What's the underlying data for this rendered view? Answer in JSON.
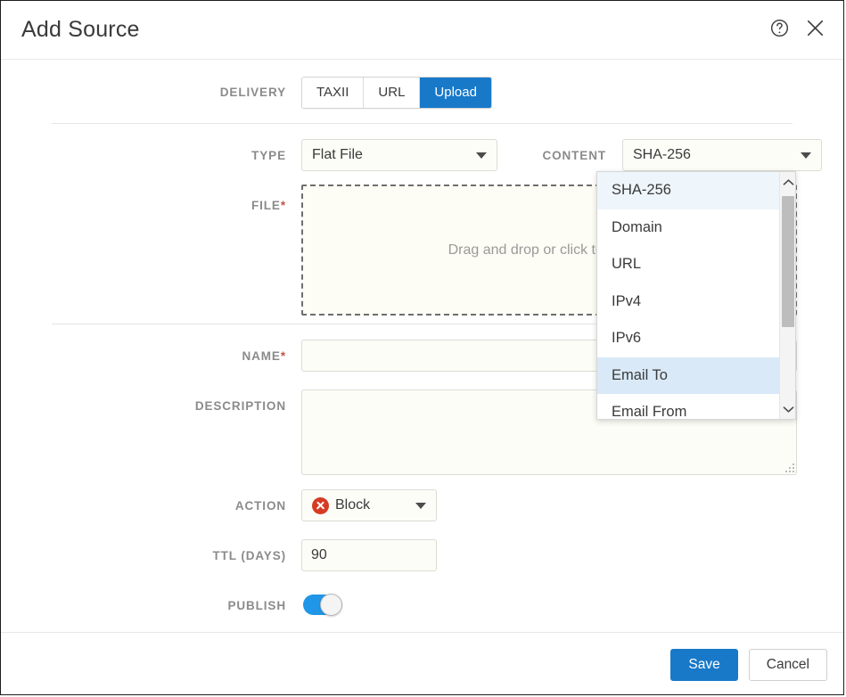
{
  "dialog": {
    "title": "Add Source",
    "help_icon": "help-circle-icon",
    "close_icon": "close-icon"
  },
  "delivery": {
    "label": "DELIVERY",
    "options": [
      "TAXII",
      "URL",
      "Upload"
    ],
    "selected": "Upload"
  },
  "type": {
    "label": "TYPE",
    "value": "Flat File"
  },
  "content": {
    "label": "CONTENT",
    "value": "SHA-256",
    "options": [
      "SHA-256",
      "Domain",
      "URL",
      "IPv4",
      "IPv6",
      "Email To",
      "Email From"
    ],
    "selected_option": "SHA-256",
    "hovered_option": "Email To"
  },
  "file": {
    "label": "FILE",
    "required_mark": "*",
    "dropzone_text": "Drag and drop or click to upload"
  },
  "name": {
    "label": "NAME",
    "required_mark": "*",
    "value": ""
  },
  "description": {
    "label": "DESCRIPTION",
    "value": ""
  },
  "action": {
    "label": "ACTION",
    "value": "Block",
    "icon": "block-circle-x-icon"
  },
  "ttl": {
    "label": "TTL (DAYS)",
    "value": "90"
  },
  "publish": {
    "label": "PUBLISH",
    "state": "on"
  },
  "footer": {
    "save_label": "Save",
    "cancel_label": "Cancel"
  },
  "colors": {
    "accent": "#1879c9",
    "danger": "#d63b23",
    "toggle_on": "#1f96e8",
    "label": "#8b8b8b",
    "required": "#c0564a"
  }
}
